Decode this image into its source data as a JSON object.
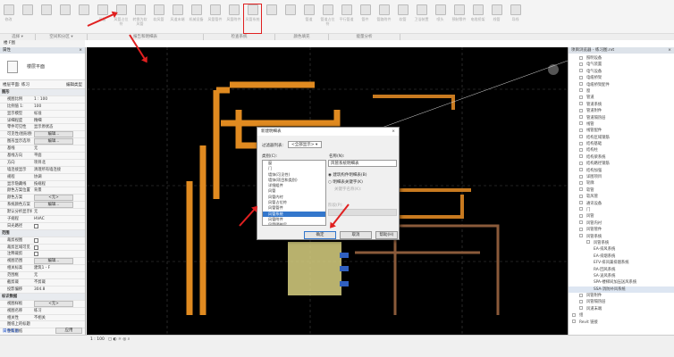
{
  "ribbon": {
    "buttons": [
      "修改",
      "",
      "",
      "",
      "",
      "风管",
      "风管占位符",
      "转换为软风管",
      "软风管",
      "风道末端",
      "机械设备",
      "风管管件",
      "风管附件",
      "风管系统",
      "",
      "",
      "管道",
      "管道占位符",
      "平行管道",
      "管件",
      "管路附件",
      "软管",
      "卫浴装置",
      "喷头",
      "预制零件",
      "电缆桥架",
      "线管",
      "导线"
    ],
    "highlighted_label": "风管系统",
    "panels": [
      "选择 ▾",
      "空间和分区 ▾",
      "报告和明细表",
      "检查系统",
      "颜色填充",
      "能量分析"
    ]
  },
  "view_selector": "楼  F图",
  "properties": {
    "title": "属性",
    "type_name": "楼层平面",
    "view_select": "楼层平面: 练习",
    "edit_type": "编辑类型",
    "rows": [
      {
        "g": "图形"
      },
      {
        "k": "视图比例",
        "v": "1 : 100"
      },
      {
        "k": "比例值 1:",
        "v": "100"
      },
      {
        "k": "显示模型",
        "v": "标准"
      },
      {
        "k": "详细程度",
        "v": "精细"
      },
      {
        "k": "零件可见性",
        "v": "显示原状态"
      },
      {
        "k": "可见性/图形替换",
        "b": "编辑..."
      },
      {
        "k": "图形显示选项",
        "b": "编辑..."
      },
      {
        "k": "基线",
        "v": "无"
      },
      {
        "k": "基线方向",
        "v": "平面"
      },
      {
        "k": "方向",
        "v": "项目北"
      },
      {
        "k": "墙连接显示",
        "v": "清理所有墙连接"
      },
      {
        "k": "规程",
        "v": "协调"
      },
      {
        "k": "显示隐藏线",
        "v": "按规程"
      },
      {
        "k": "颜色方案位置",
        "v": "背景"
      },
      {
        "k": "颜色方案",
        "b": "<无>"
      },
      {
        "k": "系统颜色方案",
        "b": "编辑..."
      },
      {
        "k": "默认分析显示样...",
        "v": "无"
      },
      {
        "k": "子规程",
        "v": "HVAC"
      },
      {
        "k": "日光路径",
        "c": true
      },
      {
        "g": "范围"
      },
      {
        "k": "裁剪视图",
        "c": true
      },
      {
        "k": "裁剪区域可见",
        "c": true
      },
      {
        "k": "注释裁剪",
        "c": true
      },
      {
        "k": "视图范围",
        "b": "编辑..."
      },
      {
        "k": "相关标高",
        "v": "建筑1 - F"
      },
      {
        "k": "范围框",
        "v": "无"
      },
      {
        "k": "截剪裁",
        "v": "不剪裁"
      },
      {
        "k": "投影偏移",
        "v": "304.8"
      },
      {
        "g": "标识数据"
      },
      {
        "k": "视图样板",
        "b": "<无>"
      },
      {
        "k": "视图名称",
        "v": "练习"
      },
      {
        "k": "相关性",
        "v": "不相关"
      },
      {
        "k": "图纸上的标题",
        "v": ""
      },
      {
        "k": "参照图纸",
        "v": ""
      }
    ],
    "help_link": "属性帮助",
    "apply": "应用"
  },
  "browser": {
    "title": "项目浏览器 - 练习图.rvt",
    "items": [
      {
        "t": "照明设备",
        "d": 1
      },
      {
        "t": "电气装置",
        "d": 1
      },
      {
        "t": "电气设备",
        "d": 1
      },
      {
        "t": "电缆桥架",
        "d": 1
      },
      {
        "t": "电缆桥架配件",
        "d": 1
      },
      {
        "t": "窗",
        "d": 1
      },
      {
        "t": "管道",
        "d": 1
      },
      {
        "t": "管道系统",
        "d": 1
      },
      {
        "t": "管道附件",
        "d": 1
      },
      {
        "t": "管道隔热层",
        "d": 1
      },
      {
        "t": "线管",
        "d": 1
      },
      {
        "t": "线管配件",
        "d": 1
      },
      {
        "t": "结构区域钢筋",
        "d": 1
      },
      {
        "t": "结构基础",
        "d": 1
      },
      {
        "t": "结构柱",
        "d": 1
      },
      {
        "t": "结构梁系统",
        "d": 1
      },
      {
        "t": "结构路径钢筋",
        "d": 1
      },
      {
        "t": "结构加强",
        "d": 1
      },
      {
        "t": "详图项目",
        "d": 1
      },
      {
        "t": "轮廓",
        "d": 1
      },
      {
        "t": "软管",
        "d": 1
      },
      {
        "t": "软风管",
        "d": 1
      },
      {
        "t": "通讯设备",
        "d": 1
      },
      {
        "t": "门",
        "d": 1
      },
      {
        "t": "风管",
        "d": 1
      },
      {
        "t": "风管内衬",
        "d": 1
      },
      {
        "t": "风管管件",
        "d": 1
      },
      {
        "t": "风管系统",
        "d": 1
      },
      {
        "t": "风管系统",
        "d": 2
      },
      {
        "t": "EA-排风系统",
        "d": 3
      },
      {
        "t": "EA-排烟系统",
        "d": 3
      },
      {
        "t": "EFV-排风兼排烟系统",
        "d": 3
      },
      {
        "t": "RA-回风系统",
        "d": 3
      },
      {
        "t": "SA-送风系统",
        "d": 3
      },
      {
        "t": "SPA-楼梯间加压送风系统",
        "d": 3
      },
      {
        "t": "SSA-消防补风系统",
        "d": 3,
        "sel": true
      },
      {
        "t": "风管附件",
        "d": 1
      },
      {
        "t": "风管隔热层",
        "d": 1
      },
      {
        "t": "风道末端",
        "d": 1
      },
      {
        "t": "组",
        "d": 0
      },
      {
        "t": "Revit 链接",
        "d": 0
      }
    ]
  },
  "dialog": {
    "title": "新建明细表",
    "filter_label": "过滤器列表:",
    "filter_value": "<全部显示>",
    "category_label": "类别(C):",
    "categories": [
      "窗",
      "门",
      "墙饰(可见性)",
      "墙饰(项目和类别)",
      "详细组件",
      "风管",
      "风管内衬",
      "风管占位符",
      "风管管件",
      "风管系统",
      "风管附件",
      "风管隔热层",
      "风道末端"
    ],
    "selected_category": "风管系统",
    "name_label": "名称(N):",
    "name_value": "风管系统明细表",
    "radio1": "建筑构件明细表(B)",
    "radio2": "明细表关键字(K)",
    "key_label": "关键字名称(K):",
    "phase_label": "阶段(P):",
    "ok": "确定",
    "cancel": "取消",
    "help": "帮助(H)"
  },
  "view_control": {
    "scale": "1 : 100"
  },
  "colors": {
    "duct": "#e08a20",
    "pipe": "#b57a4a",
    "annotation": "#e02020"
  }
}
